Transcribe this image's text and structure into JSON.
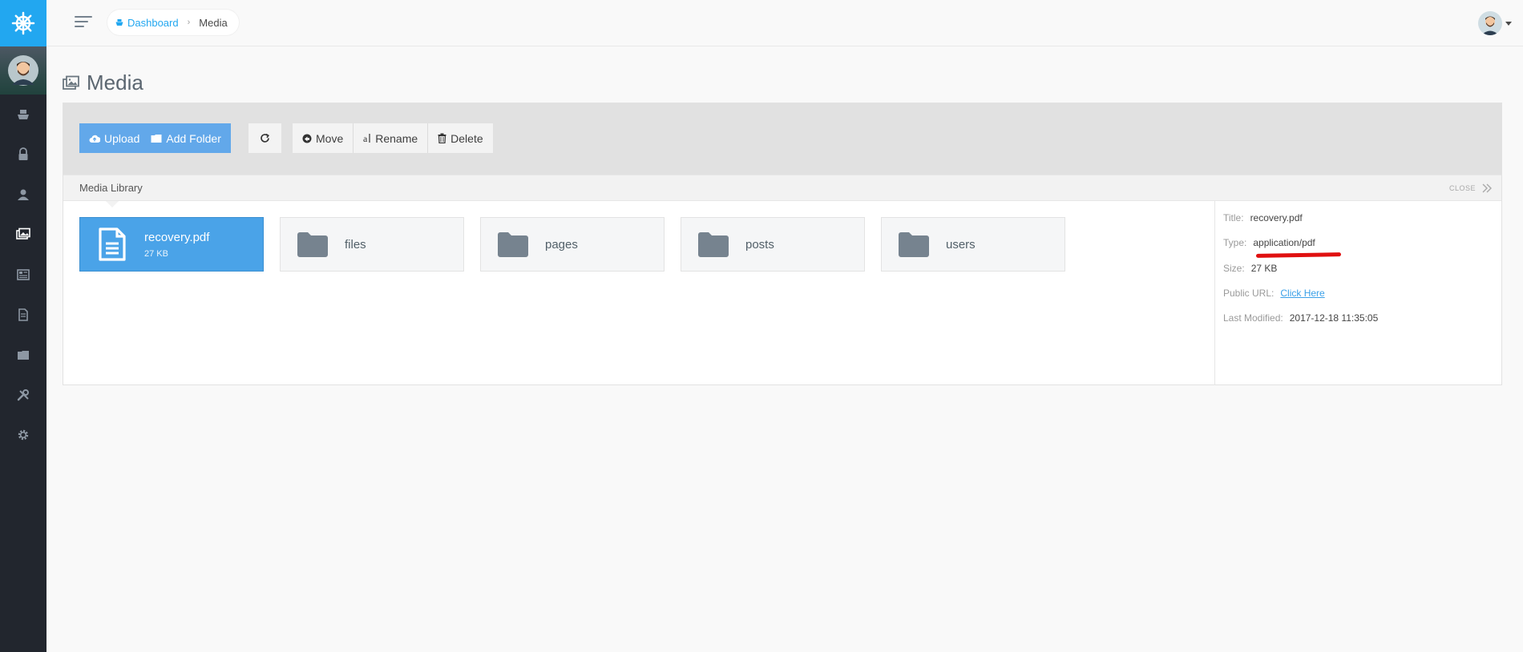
{
  "colors": {
    "brand": "#22a7f0",
    "sidebar": "#22262e",
    "primary_button": "#62a8ea",
    "selected_tile": "#4aa3e8",
    "link": "#3aa0e8",
    "annotation": "#e01010"
  },
  "sidebar": {
    "logo_icon": "ship-wheel-icon",
    "items": [
      {
        "icon": "boat-icon",
        "active": false
      },
      {
        "icon": "lock-icon",
        "active": false
      },
      {
        "icon": "user-icon",
        "active": false
      },
      {
        "icon": "images-icon",
        "active": true
      },
      {
        "icon": "newspaper-icon",
        "active": false
      },
      {
        "icon": "document-icon",
        "active": false
      },
      {
        "icon": "folder-icon",
        "active": false
      },
      {
        "icon": "tools-icon",
        "active": false
      },
      {
        "icon": "gear-icon",
        "active": false
      }
    ]
  },
  "breadcrumb": {
    "home_label": "Dashboard",
    "separator": "›",
    "current": "Media"
  },
  "page": {
    "title": "Media"
  },
  "toolbar": {
    "upload_label": "Upload",
    "add_folder_label": "Add Folder",
    "move_label": "Move",
    "rename_label": "Rename",
    "delete_label": "Delete"
  },
  "library": {
    "label": "Media Library",
    "close_label": "CLOSE"
  },
  "files": [
    {
      "name": "recovery.pdf",
      "size": "27 KB",
      "type": "file",
      "selected": true
    },
    {
      "name": "files",
      "type": "folder",
      "selected": false
    },
    {
      "name": "pages",
      "type": "folder",
      "selected": false
    },
    {
      "name": "posts",
      "type": "folder",
      "selected": false
    },
    {
      "name": "users",
      "type": "folder",
      "selected": false
    }
  ],
  "details": {
    "title_label": "Title:",
    "title_value": "recovery.pdf",
    "type_label": "Type:",
    "type_value": "application/pdf",
    "size_label": "Size:",
    "size_value": "27 KB",
    "url_label": "Public URL:",
    "url_value": "Click Here",
    "modified_label": "Last Modified:",
    "modified_value": "2017-12-18 11:35:05"
  }
}
